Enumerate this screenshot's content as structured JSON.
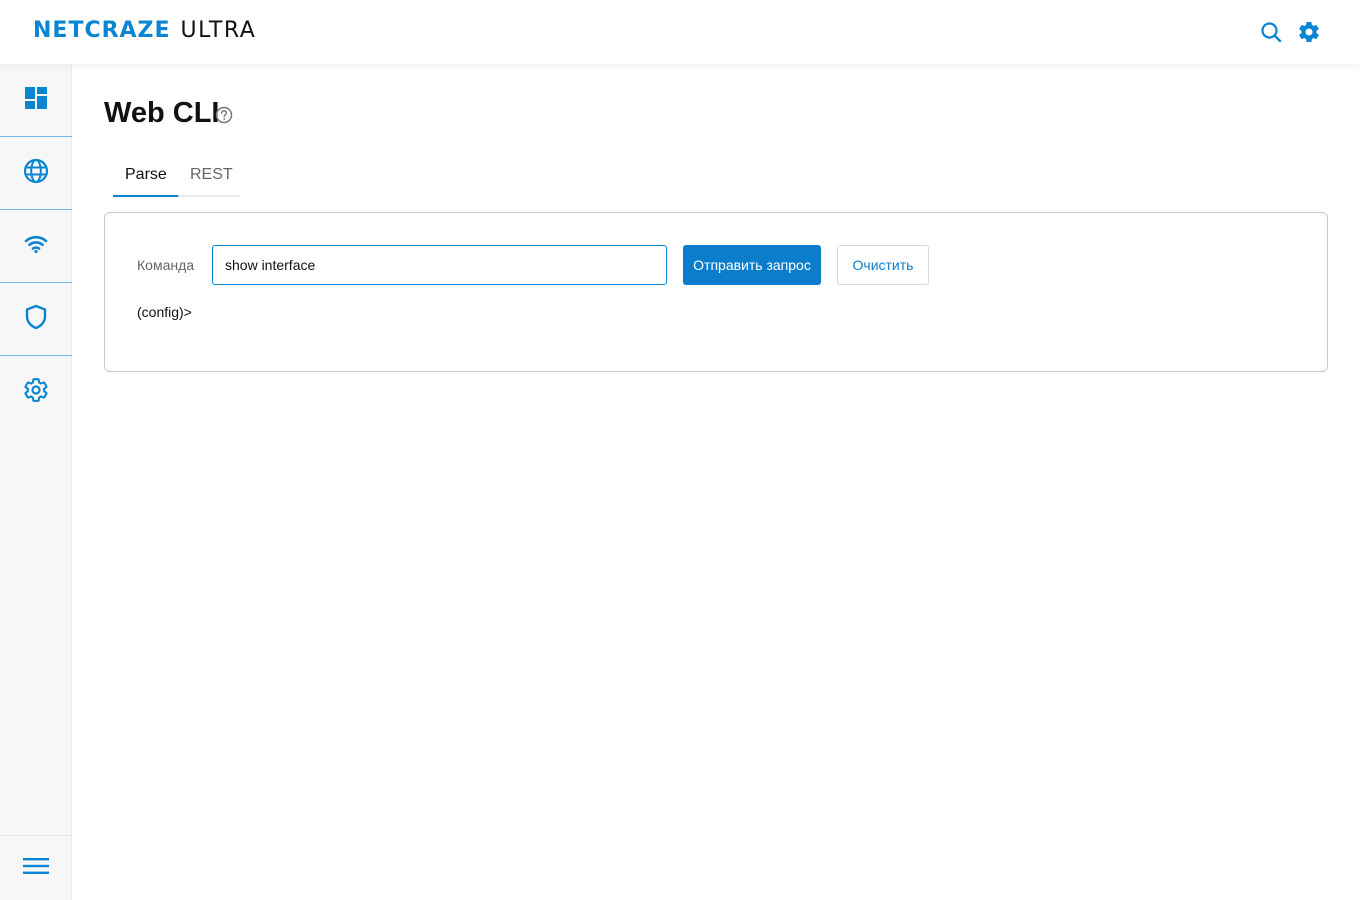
{
  "header": {
    "brand": "NETCRAZE",
    "product": "ULTRA",
    "icons": [
      "search-icon",
      "gear-icon"
    ]
  },
  "sidebar": {
    "items": [
      {
        "icon": "dashboard-icon"
      },
      {
        "icon": "globe-icon"
      },
      {
        "icon": "wifi-icon"
      },
      {
        "icon": "shield-icon"
      },
      {
        "icon": "gear-icon"
      }
    ],
    "bottom_icon": "menu-icon"
  },
  "page": {
    "title": "Web CLI",
    "help_icon": "help-circle-icon"
  },
  "tabs": [
    {
      "label": "Parse",
      "active": true
    },
    {
      "label": "REST",
      "active": false
    }
  ],
  "cli": {
    "command_label": "Команда",
    "command_value": "show interface",
    "send_label": "Отправить запрос",
    "clear_label": "Очистить",
    "prompt": "(config)>"
  },
  "colors": {
    "accent": "#0a85d1",
    "button_primary": "#0a7ecb"
  }
}
